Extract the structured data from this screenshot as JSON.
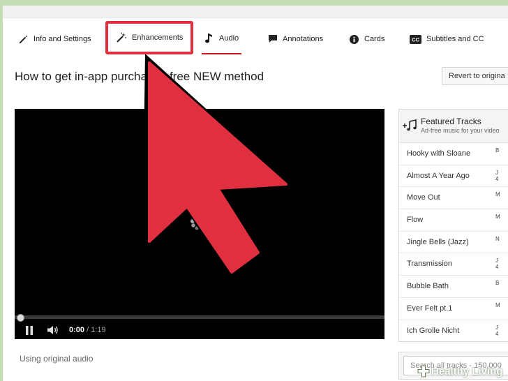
{
  "tabs": [
    {
      "label": "Info and Settings",
      "icon": "pencil-icon"
    },
    {
      "label": "Enhancements",
      "icon": "magic-wand-icon"
    },
    {
      "label": "Audio",
      "icon": "music-note-icon"
    },
    {
      "label": "Annotations",
      "icon": "speech-bubble-icon"
    },
    {
      "label": "Cards",
      "icon": "info-icon"
    },
    {
      "label": "Subtitles and CC",
      "icon": "cc-icon"
    }
  ],
  "active_tab": "Audio",
  "highlighted_tab": "Enhancements",
  "highlight_color": "#e0303f",
  "page_title": "How to get in-app purcha",
  "page_title_rest": "free NEW method",
  "revert_label": "Revert to origina",
  "player": {
    "current_time": "0:00",
    "duration": "/ 1:19",
    "progress": 0.0
  },
  "using_audio": "Using original audio",
  "featured": {
    "title": "Featured Tracks",
    "subtitle": "Ad-free music for your video",
    "tracks": [
      {
        "name": "Hooky with Sloane",
        "meta": "B"
      },
      {
        "name": "Almost A Year Ago",
        "meta": "J\n4"
      },
      {
        "name": "Move Out",
        "meta": "M"
      },
      {
        "name": "Flow",
        "meta": "M"
      },
      {
        "name": "Jingle Bells (Jazz)",
        "meta": "N"
      },
      {
        "name": "Transmission",
        "meta": "J\n4"
      },
      {
        "name": "Bubble Bath",
        "meta": "B"
      },
      {
        "name": "Ever Felt pt.1",
        "meta": "M"
      },
      {
        "name": "Ich Grolle Nicht",
        "meta": "J\n4"
      }
    ]
  },
  "search": {
    "placeholder": "Search all tracks - 150,000"
  },
  "brand": {
    "name": "Healthy Living",
    "color": "#ffffff"
  },
  "arrow_color": "#e0303f"
}
